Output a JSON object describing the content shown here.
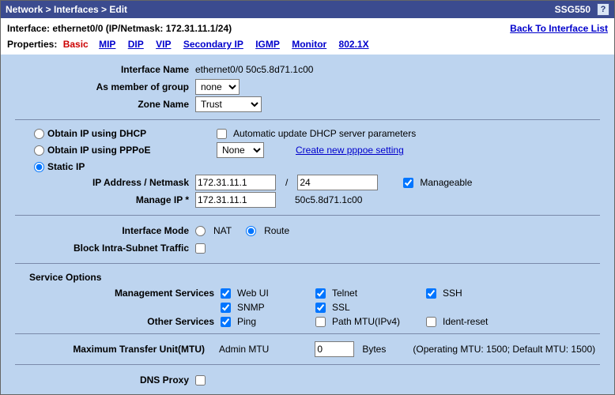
{
  "title_bar": {
    "breadcrumb": "Network > Interfaces > Edit",
    "hostname": "SSG550",
    "help": "?"
  },
  "header": {
    "interface_line": "Interface: ethernet0/0 (IP/Netmask: 172.31.11.1/24)",
    "back_link": "Back To Interface List",
    "properties_label": "Properties:",
    "basic": "Basic",
    "tabs": {
      "mip": "MIP",
      "dip": "DIP",
      "vip": "VIP",
      "sip": "Secondary IP",
      "igmp": "IGMP",
      "monitor": "Monitor",
      "dot1x": "802.1X"
    }
  },
  "info": {
    "iface_name_label": "Interface Name",
    "iface_name_value": "ethernet0/0 50c5.8d71.1c00",
    "member_label": "As member of group",
    "member_value": "none",
    "zone_label": "Zone Name",
    "zone_value": "Trust"
  },
  "ip": {
    "dhcp_label": "Obtain IP using DHCP",
    "dhcp_auto_label": "Automatic update DHCP server parameters",
    "pppoe_label": "Obtain IP using PPPoE",
    "pppoe_select": "None",
    "pppoe_link": "Create new pppoe setting",
    "static_label": "Static IP",
    "addr_label": "IP Address / Netmask",
    "addr_value": "172.31.11.1",
    "mask_value": "24",
    "slash": "/",
    "manageable_label": "Manageable",
    "manage_ip_label": "Manage IP *",
    "manage_ip_value": "172.31.11.1",
    "mac": "50c5.8d71.1c00"
  },
  "mode": {
    "mode_label": "Interface Mode",
    "nat": "NAT",
    "route": "Route",
    "block_label": "Block Intra-Subnet Traffic"
  },
  "svc": {
    "section": "Service Options",
    "mgmt_label": "Management Services",
    "webui": "Web UI",
    "telnet": "Telnet",
    "ssh": "SSH",
    "snmp": "SNMP",
    "ssl": "SSL",
    "other_label": "Other Services",
    "ping": "Ping",
    "pmtu": "Path MTU(IPv4)",
    "ident": "Ident-reset"
  },
  "mtu": {
    "label": "Maximum Transfer Unit(MTU)",
    "admin_label": "Admin MTU",
    "value": "0",
    "bytes": "Bytes",
    "info": "(Operating MTU: 1500; Default MTU: 1500)"
  },
  "dns": {
    "label": "DNS Proxy"
  }
}
